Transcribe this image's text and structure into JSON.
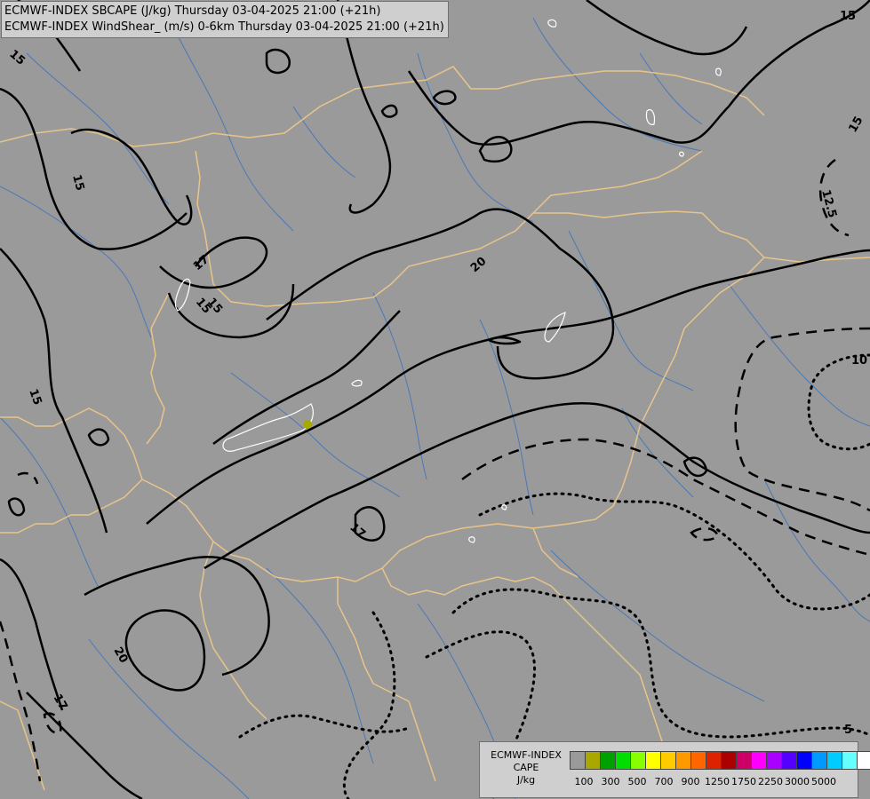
{
  "title": {
    "line1": "ECMWF-INDEX SBCAPE (J/kg) Thursday 03-04-2025 21:00 (+21h)",
    "line2": "ECMWF-INDEX WindShear_ (m/s) 0-6km Thursday 03-04-2025 21:00 (+21h)"
  },
  "contour_labels": [
    "15",
    "15",
    "15",
    "15",
    "15",
    "15",
    "12.5",
    "17",
    "15",
    "20",
    "10",
    "17",
    "20",
    "17",
    "5"
  ],
  "legend": {
    "label_lines": [
      "ECMWF-INDEX",
      "CAPE",
      "J/kg"
    ],
    "colors": [
      "#9a9a9a",
      "#a8a800",
      "#00a000",
      "#00dd00",
      "#88ff00",
      "#ffff00",
      "#ffcc00",
      "#ff9900",
      "#ff6600",
      "#dd2200",
      "#aa0000",
      "#cc0066",
      "#ff00ff",
      "#aa00ff",
      "#5500ff",
      "#0000ff",
      "#0099ff",
      "#00ccff",
      "#66ffff",
      "#ffffff"
    ],
    "tick_labels": [
      "100",
      "300",
      "500",
      "700",
      "900",
      "1250",
      "1750",
      "2250",
      "3000",
      "5000"
    ]
  },
  "colors": {
    "background": "#9a9a9a",
    "borders": "#e8c48a",
    "rivers": "#4a78b8",
    "contours": "#000000",
    "cape_outline": "#ffffff",
    "cape_spot": "#a8a800"
  }
}
